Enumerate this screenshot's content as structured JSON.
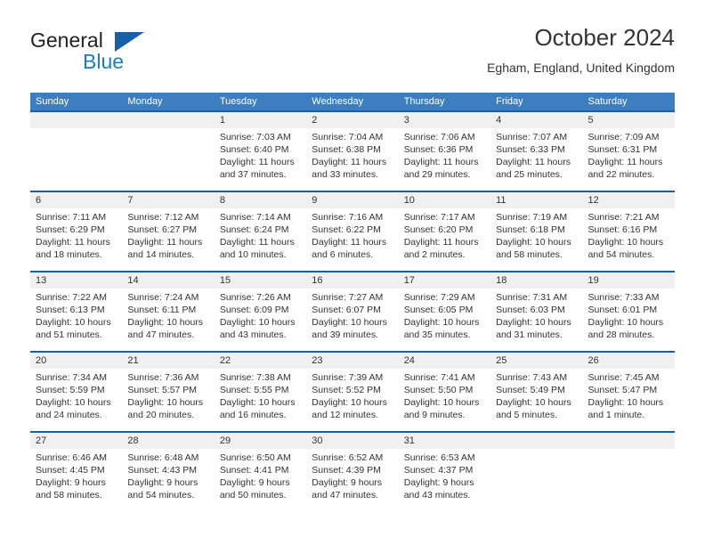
{
  "brand": {
    "name_part1": "General",
    "name_part2": "Blue"
  },
  "header": {
    "title": "October 2024",
    "subtitle": "Egham, England, United Kingdom"
  },
  "colors": {
    "header_blue": "#3c7ebf",
    "row_border_blue": "#1560a8",
    "daynum_band": "#f0f0f0",
    "logo_blue": "#1b7bc4",
    "text": "#333333"
  },
  "weekdays": [
    "Sunday",
    "Monday",
    "Tuesday",
    "Wednesday",
    "Thursday",
    "Friday",
    "Saturday"
  ],
  "weeks": [
    [
      {
        "day": "",
        "lines": []
      },
      {
        "day": "",
        "lines": []
      },
      {
        "day": "1",
        "lines": [
          "Sunrise: 7:03 AM",
          "Sunset: 6:40 PM",
          "Daylight: 11 hours",
          "and 37 minutes."
        ]
      },
      {
        "day": "2",
        "lines": [
          "Sunrise: 7:04 AM",
          "Sunset: 6:38 PM",
          "Daylight: 11 hours",
          "and 33 minutes."
        ]
      },
      {
        "day": "3",
        "lines": [
          "Sunrise: 7:06 AM",
          "Sunset: 6:36 PM",
          "Daylight: 11 hours",
          "and 29 minutes."
        ]
      },
      {
        "day": "4",
        "lines": [
          "Sunrise: 7:07 AM",
          "Sunset: 6:33 PM",
          "Daylight: 11 hours",
          "and 25 minutes."
        ]
      },
      {
        "day": "5",
        "lines": [
          "Sunrise: 7:09 AM",
          "Sunset: 6:31 PM",
          "Daylight: 11 hours",
          "and 22 minutes."
        ]
      }
    ],
    [
      {
        "day": "6",
        "lines": [
          "Sunrise: 7:11 AM",
          "Sunset: 6:29 PM",
          "Daylight: 11 hours",
          "and 18 minutes."
        ]
      },
      {
        "day": "7",
        "lines": [
          "Sunrise: 7:12 AM",
          "Sunset: 6:27 PM",
          "Daylight: 11 hours",
          "and 14 minutes."
        ]
      },
      {
        "day": "8",
        "lines": [
          "Sunrise: 7:14 AM",
          "Sunset: 6:24 PM",
          "Daylight: 11 hours",
          "and 10 minutes."
        ]
      },
      {
        "day": "9",
        "lines": [
          "Sunrise: 7:16 AM",
          "Sunset: 6:22 PM",
          "Daylight: 11 hours",
          "and 6 minutes."
        ]
      },
      {
        "day": "10",
        "lines": [
          "Sunrise: 7:17 AM",
          "Sunset: 6:20 PM",
          "Daylight: 11 hours",
          "and 2 minutes."
        ]
      },
      {
        "day": "11",
        "lines": [
          "Sunrise: 7:19 AM",
          "Sunset: 6:18 PM",
          "Daylight: 10 hours",
          "and 58 minutes."
        ]
      },
      {
        "day": "12",
        "lines": [
          "Sunrise: 7:21 AM",
          "Sunset: 6:16 PM",
          "Daylight: 10 hours",
          "and 54 minutes."
        ]
      }
    ],
    [
      {
        "day": "13",
        "lines": [
          "Sunrise: 7:22 AM",
          "Sunset: 6:13 PM",
          "Daylight: 10 hours",
          "and 51 minutes."
        ]
      },
      {
        "day": "14",
        "lines": [
          "Sunrise: 7:24 AM",
          "Sunset: 6:11 PM",
          "Daylight: 10 hours",
          "and 47 minutes."
        ]
      },
      {
        "day": "15",
        "lines": [
          "Sunrise: 7:26 AM",
          "Sunset: 6:09 PM",
          "Daylight: 10 hours",
          "and 43 minutes."
        ]
      },
      {
        "day": "16",
        "lines": [
          "Sunrise: 7:27 AM",
          "Sunset: 6:07 PM",
          "Daylight: 10 hours",
          "and 39 minutes."
        ]
      },
      {
        "day": "17",
        "lines": [
          "Sunrise: 7:29 AM",
          "Sunset: 6:05 PM",
          "Daylight: 10 hours",
          "and 35 minutes."
        ]
      },
      {
        "day": "18",
        "lines": [
          "Sunrise: 7:31 AM",
          "Sunset: 6:03 PM",
          "Daylight: 10 hours",
          "and 31 minutes."
        ]
      },
      {
        "day": "19",
        "lines": [
          "Sunrise: 7:33 AM",
          "Sunset: 6:01 PM",
          "Daylight: 10 hours",
          "and 28 minutes."
        ]
      }
    ],
    [
      {
        "day": "20",
        "lines": [
          "Sunrise: 7:34 AM",
          "Sunset: 5:59 PM",
          "Daylight: 10 hours",
          "and 24 minutes."
        ]
      },
      {
        "day": "21",
        "lines": [
          "Sunrise: 7:36 AM",
          "Sunset: 5:57 PM",
          "Daylight: 10 hours",
          "and 20 minutes."
        ]
      },
      {
        "day": "22",
        "lines": [
          "Sunrise: 7:38 AM",
          "Sunset: 5:55 PM",
          "Daylight: 10 hours",
          "and 16 minutes."
        ]
      },
      {
        "day": "23",
        "lines": [
          "Sunrise: 7:39 AM",
          "Sunset: 5:52 PM",
          "Daylight: 10 hours",
          "and 12 minutes."
        ]
      },
      {
        "day": "24",
        "lines": [
          "Sunrise: 7:41 AM",
          "Sunset: 5:50 PM",
          "Daylight: 10 hours",
          "and 9 minutes."
        ]
      },
      {
        "day": "25",
        "lines": [
          "Sunrise: 7:43 AM",
          "Sunset: 5:49 PM",
          "Daylight: 10 hours",
          "and 5 minutes."
        ]
      },
      {
        "day": "26",
        "lines": [
          "Sunrise: 7:45 AM",
          "Sunset: 5:47 PM",
          "Daylight: 10 hours",
          "and 1 minute."
        ]
      }
    ],
    [
      {
        "day": "27",
        "lines": [
          "Sunrise: 6:46 AM",
          "Sunset: 4:45 PM",
          "Daylight: 9 hours",
          "and 58 minutes."
        ]
      },
      {
        "day": "28",
        "lines": [
          "Sunrise: 6:48 AM",
          "Sunset: 4:43 PM",
          "Daylight: 9 hours",
          "and 54 minutes."
        ]
      },
      {
        "day": "29",
        "lines": [
          "Sunrise: 6:50 AM",
          "Sunset: 4:41 PM",
          "Daylight: 9 hours",
          "and 50 minutes."
        ]
      },
      {
        "day": "30",
        "lines": [
          "Sunrise: 6:52 AM",
          "Sunset: 4:39 PM",
          "Daylight: 9 hours",
          "and 47 minutes."
        ]
      },
      {
        "day": "31",
        "lines": [
          "Sunrise: 6:53 AM",
          "Sunset: 4:37 PM",
          "Daylight: 9 hours",
          "and 43 minutes."
        ]
      },
      {
        "day": "",
        "lines": []
      },
      {
        "day": "",
        "lines": []
      }
    ]
  ]
}
